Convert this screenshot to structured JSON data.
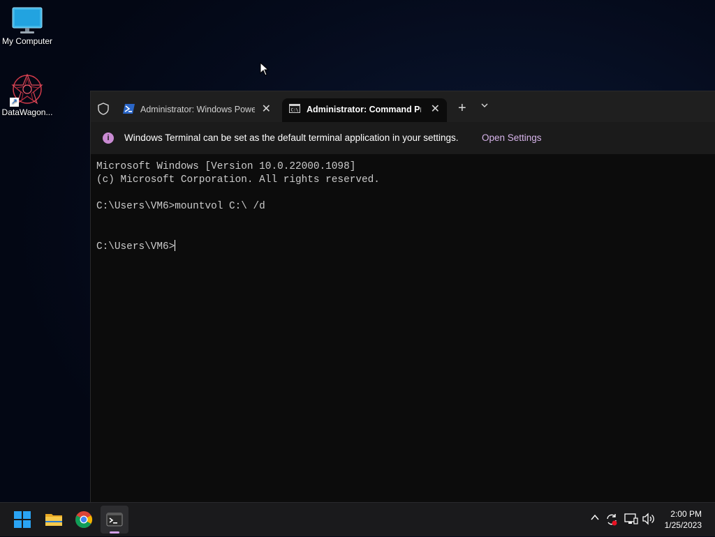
{
  "desktop": {
    "icons": [
      {
        "label": "My Computer"
      },
      {
        "label": "DataWagon..."
      }
    ]
  },
  "terminal": {
    "tabs": [
      {
        "title": "Administrator: Windows PowerShell"
      },
      {
        "title": "Administrator:  Command Prompt"
      }
    ],
    "infobar": {
      "message": "Windows Terminal can be set as the default terminal application in your settings.",
      "link": "Open Settings"
    },
    "console": {
      "lines": [
        "Microsoft Windows [Version 10.0.22000.1098]",
        "(c) Microsoft Corporation. All rights reserved.",
        "",
        "C:\\Users\\VM6>mountvol C:\\ /d",
        "",
        "",
        "C:\\Users\\VM6>"
      ]
    }
  },
  "taskbar": {
    "clock": {
      "time": "2:00 PM",
      "date": "1/25/2023"
    }
  },
  "colors": {
    "accent": "#d3a0e8",
    "terminal_bg": "#0c0c0c",
    "link": "#d7b4ea"
  }
}
